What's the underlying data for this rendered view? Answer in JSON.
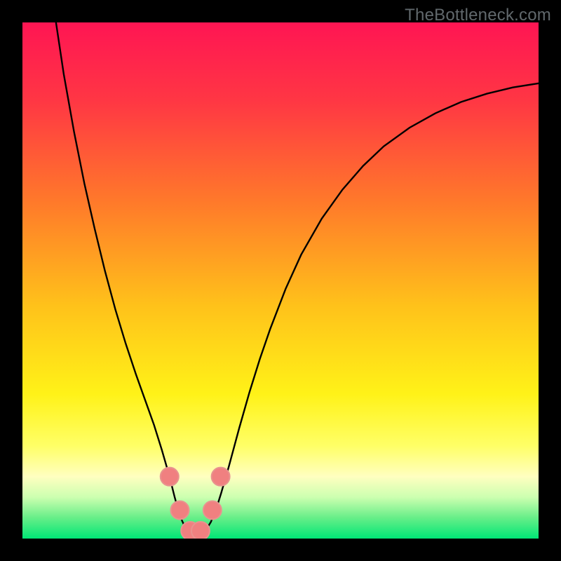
{
  "watermark": "TheBottleneck.com",
  "chart_data": {
    "type": "line",
    "title": "",
    "xlabel": "",
    "ylabel": "",
    "xlim": [
      0,
      100
    ],
    "ylim": [
      0,
      100
    ],
    "grid": false,
    "legend": false,
    "background_gradient": {
      "stops": [
        {
          "offset": 0.0,
          "color": "#ff1553"
        },
        {
          "offset": 0.15,
          "color": "#ff3644"
        },
        {
          "offset": 0.35,
          "color": "#ff7a2a"
        },
        {
          "offset": 0.55,
          "color": "#ffc21a"
        },
        {
          "offset": 0.72,
          "color": "#fff218"
        },
        {
          "offset": 0.82,
          "color": "#ffff66"
        },
        {
          "offset": 0.88,
          "color": "#ffffc0"
        },
        {
          "offset": 0.92,
          "color": "#ccffb0"
        },
        {
          "offset": 0.96,
          "color": "#66ee88"
        },
        {
          "offset": 1.0,
          "color": "#00e676"
        }
      ]
    },
    "series": [
      {
        "name": "left-branch",
        "stroke": "#000000",
        "points_xy": [
          [
            6.5,
            100.0
          ],
          [
            8.0,
            90.0
          ],
          [
            10.0,
            78.8
          ],
          [
            12.0,
            68.8
          ],
          [
            14.0,
            60.0
          ],
          [
            16.0,
            51.8
          ],
          [
            18.0,
            44.4
          ],
          [
            20.0,
            37.8
          ],
          [
            22.0,
            31.8
          ],
          [
            24.0,
            26.2
          ],
          [
            25.5,
            22.0
          ],
          [
            27.0,
            17.2
          ],
          [
            28.5,
            12.0
          ],
          [
            29.5,
            8.0
          ],
          [
            30.5,
            4.4
          ],
          [
            31.5,
            2.2
          ],
          [
            32.5,
            0.8
          ],
          [
            33.5,
            0.0
          ]
        ]
      },
      {
        "name": "right-branch",
        "stroke": "#000000",
        "points_xy": [
          [
            33.5,
            0.0
          ],
          [
            34.5,
            0.5
          ],
          [
            35.5,
            1.6
          ],
          [
            36.5,
            3.2
          ],
          [
            37.5,
            5.6
          ],
          [
            38.5,
            8.8
          ],
          [
            40.0,
            14.0
          ],
          [
            42.0,
            21.4
          ],
          [
            44.0,
            28.4
          ],
          [
            46.0,
            34.8
          ],
          [
            48.0,
            40.6
          ],
          [
            51.0,
            48.4
          ],
          [
            54.0,
            55.0
          ],
          [
            58.0,
            62.0
          ],
          [
            62.0,
            67.6
          ],
          [
            66.0,
            72.2
          ],
          [
            70.0,
            76.0
          ],
          [
            75.0,
            79.6
          ],
          [
            80.0,
            82.4
          ],
          [
            85.0,
            84.6
          ],
          [
            90.0,
            86.2
          ],
          [
            95.0,
            87.4
          ],
          [
            100.0,
            88.2
          ]
        ]
      }
    ],
    "markers": {
      "name": "minimum-cluster",
      "color": "#f08080",
      "stroke": "#e8938f",
      "radius_px": 13,
      "points_xy": [
        [
          28.5,
          12.0
        ],
        [
          30.5,
          5.5
        ],
        [
          32.5,
          1.5
        ],
        [
          34.5,
          1.5
        ],
        [
          36.8,
          5.5
        ],
        [
          38.4,
          12.0
        ]
      ]
    }
  }
}
